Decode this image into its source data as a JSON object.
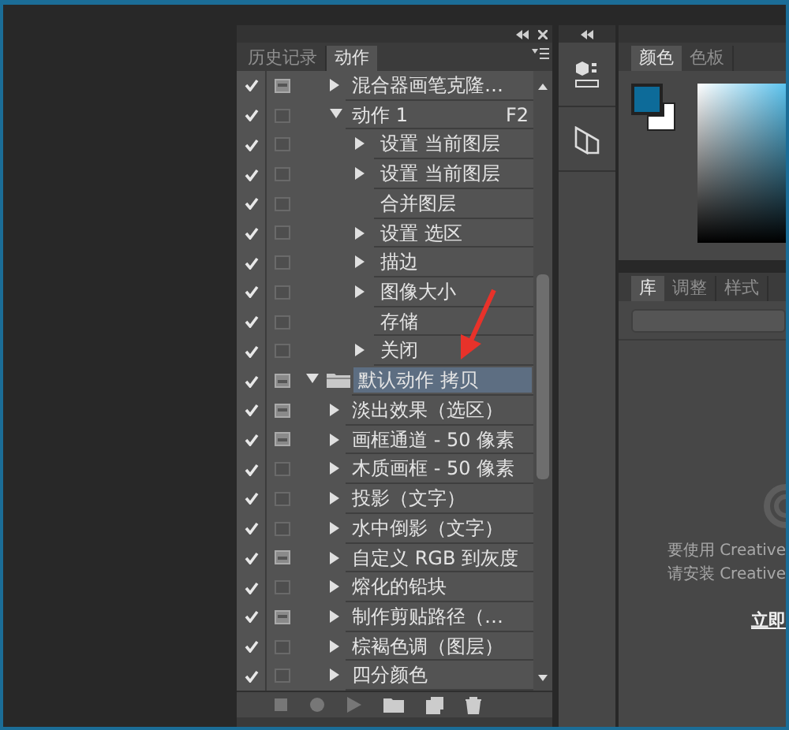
{
  "actions_panel": {
    "tabs": [
      {
        "label": "历史记录",
        "selected": false
      },
      {
        "label": "动作",
        "selected": true
      }
    ],
    "rows": [
      {
        "kind": "action",
        "label": "混合器画笔克隆…",
        "checked": true,
        "dialog": true,
        "expanded": false,
        "selected": false
      },
      {
        "kind": "action",
        "label": "动作 1",
        "shortcut": "F2",
        "checked": true,
        "dialog": false,
        "expanded": true,
        "selected": false,
        "children": [
          {
            "kind": "command",
            "label": "设置 当前图层",
            "checked": true,
            "dialog": false,
            "expandable": true
          },
          {
            "kind": "command",
            "label": "设置 当前图层",
            "checked": true,
            "dialog": false,
            "expandable": true
          },
          {
            "kind": "command",
            "label": "合并图层",
            "checked": true,
            "dialog": false,
            "expandable": false
          },
          {
            "kind": "command",
            "label": "设置 选区",
            "checked": true,
            "dialog": false,
            "expandable": true
          },
          {
            "kind": "command",
            "label": "描边",
            "checked": true,
            "dialog": false,
            "expandable": true
          },
          {
            "kind": "command",
            "label": "图像大小",
            "checked": true,
            "dialog": false,
            "expandable": true
          },
          {
            "kind": "command",
            "label": "存储",
            "checked": true,
            "dialog": false,
            "expandable": false
          },
          {
            "kind": "command",
            "label": "关闭",
            "checked": true,
            "dialog": false,
            "expandable": true
          }
        ]
      },
      {
        "kind": "set",
        "label": "默认动作 拷贝",
        "checked": true,
        "dialog": true,
        "expanded": true,
        "selected": true,
        "children": [
          {
            "kind": "action",
            "label": "淡出效果（选区）",
            "checked": true,
            "dialog": true,
            "expanded": false,
            "selected": false
          },
          {
            "kind": "action",
            "label": "画框通道 - 50 像素",
            "checked": true,
            "dialog": true,
            "expanded": false,
            "selected": false
          },
          {
            "kind": "action",
            "label": "木质画框 - 50 像素",
            "checked": true,
            "dialog": false,
            "expanded": false,
            "selected": false
          },
          {
            "kind": "action",
            "label": "投影（文字）",
            "checked": true,
            "dialog": false,
            "expanded": false,
            "selected": false
          },
          {
            "kind": "action",
            "label": "水中倒影（文字）",
            "checked": true,
            "dialog": false,
            "expanded": false,
            "selected": false
          },
          {
            "kind": "action",
            "label": "自定义 RGB 到灰度",
            "checked": true,
            "dialog": true,
            "expanded": false,
            "selected": false
          },
          {
            "kind": "action",
            "label": "熔化的铅块",
            "checked": true,
            "dialog": false,
            "expanded": false,
            "selected": false
          },
          {
            "kind": "action",
            "label": "制作剪贴路径（…",
            "checked": true,
            "dialog": true,
            "expanded": false,
            "selected": false
          },
          {
            "kind": "action",
            "label": "棕褐色调（图层）",
            "checked": true,
            "dialog": false,
            "expanded": false,
            "selected": false
          },
          {
            "kind": "action",
            "label": "四分颜色",
            "checked": true,
            "dialog": false,
            "expanded": false,
            "selected": false
          }
        ]
      }
    ]
  },
  "color_panel": {
    "tabs": [
      {
        "label": "颜色",
        "selected": true
      },
      {
        "label": "色板",
        "selected": false
      }
    ],
    "swatches": [
      {
        "kind": "foreground",
        "color": "#0d6b99"
      },
      {
        "kind": "background",
        "color": "#ffffff"
      }
    ]
  },
  "library_panel": {
    "tabs": [
      {
        "label": "库",
        "selected": true
      },
      {
        "label": "调整",
        "selected": false
      },
      {
        "label": "样式",
        "selected": false
      }
    ],
    "message_lines": [
      "要使用 Creative",
      "请安装 Creative"
    ],
    "link": "立即"
  }
}
